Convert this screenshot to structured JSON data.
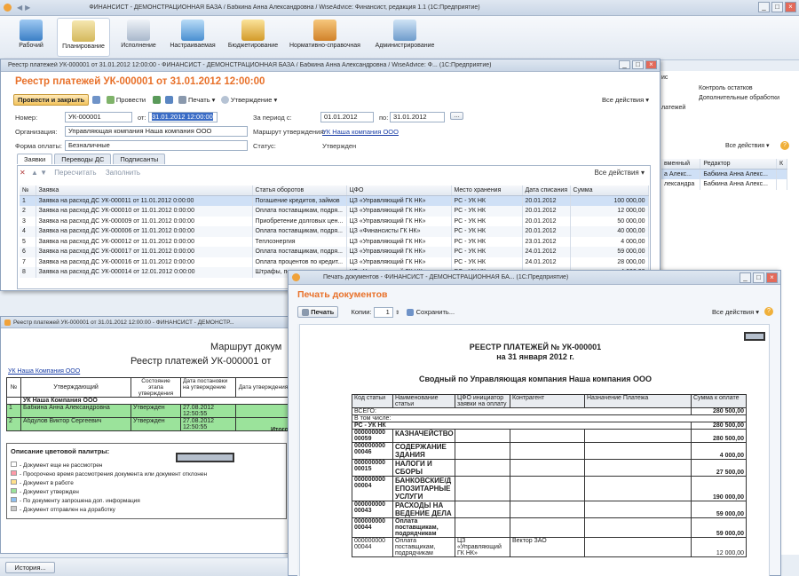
{
  "app": {
    "title": "ФИНАНСИСТ - ДЕМОНСТРАЦИОННАЯ БАЗА / Бабкина Анна Александровна / WiseAdvice: Финансист, редакция 1.1  (1С:Предприятие)",
    "sections": [
      "Рабочий",
      "Планирование",
      "Исполнение",
      "Настраиваемая",
      "Бюджетирование",
      "Нормативно-справочная",
      "Администрирование"
    ],
    "right_items": [
      "Контроль остатков",
      "Дополнительные обработки"
    ],
    "right_partial": [
      "ис",
      "латежей"
    ],
    "all_actions": "Все действия ▾",
    "back_grid": {
      "headers": [
        "вменный",
        "Редактор",
        "К"
      ],
      "rows": [
        [
          "а Алекс...",
          "Бабкина Анна Алекс..."
        ],
        [
          "лександра",
          "Бабкина Анна Алекс..."
        ]
      ]
    },
    "history_btn": "История..."
  },
  "reg": {
    "window_title": "Реестр платежей УК-000001 от 31.01.2012 12:00:00 - ФИНАНСИСТ - ДЕМОНСТРАЦИОННАЯ БАЗА / Бабкина Анна Александровна / WiseAdvice: Ф... (1С:Предприятие)",
    "header": "Реестр платежей УК-000001 от 31.01.2012 12:00:00",
    "toolbar": {
      "post_close": "Провести и закрыть",
      "post": "Провести",
      "print": "Печать ▾",
      "approval": "Утверждение ▾",
      "all_actions": "Все действия ▾"
    },
    "form": {
      "number_lbl": "Номер:",
      "number": "УК-000001",
      "from_lbl": "от:",
      "date": "31.01.2012 12:00:00",
      "period_lbl": "За период с:",
      "period_from": "01.01.2012",
      "to_lbl": "по:",
      "period_to": "31.01.2012",
      "org_lbl": "Организация:",
      "org": "Управляющая компания Наша компания ООО",
      "route_lbl": "Маршрут утверждения:",
      "route": "УК Наша компания ООО",
      "pay_lbl": "Форма оплаты:",
      "pay": "Безналичные",
      "status_lbl": "Статус:",
      "status": "Утвержден"
    },
    "tabs": [
      "Заявки",
      "Переводы ДС",
      "Подписанты"
    ],
    "subtoolbar": {
      "recalc": "Пересчитать",
      "fill": "Заполнить",
      "all_actions": "Все действия ▾"
    },
    "grid_headers": [
      "№",
      "Заявка",
      "Статья оборотов",
      "ЦФО",
      "Место хранения",
      "Дата списания",
      "Сумма"
    ],
    "rows": [
      [
        "1",
        "Заявка на расход ДС УК-000011 от 11.01.2012 0:00:00",
        "Погашение кредитов, займов",
        "ЦЗ «Управляющий ГК НК»",
        "РС - УК НК",
        "20.01.2012",
        "100 000,00"
      ],
      [
        "2",
        "Заявка на расход ДС УК-000010 от 11.01.2012 0:00:00",
        "Оплата поставщикам, подря...",
        "ЦЗ «Управляющий ГК НК»",
        "РС - УК НК",
        "20.01.2012",
        "12 000,00"
      ],
      [
        "3",
        "Заявка на расход ДС УК-000009 от 11.01.2012 0:00:00",
        "Приобретение долговых цен...",
        "ЦЗ «Управляющий ГК НК»",
        "РС - УК НК",
        "20.01.2012",
        "50 000,00"
      ],
      [
        "4",
        "Заявка на расход ДС УК-000006 от 11.01.2012 0:00:00",
        "Оплата поставщикам, подря...",
        "ЦЗ «Финансисты ГК НК»",
        "РС - УК НК",
        "20.01.2012",
        "40 000,00"
      ],
      [
        "5",
        "Заявка на расход ДС УК-000012 от 11.01.2012 0:00:00",
        "Теплоэнергия",
        "ЦЗ «Управляющий ГК НК»",
        "РС - УК НК",
        "23.01.2012",
        "4 000,00"
      ],
      [
        "6",
        "Заявка на расход ДС УК-000017 от 11.01.2012 0:00:00",
        "Оплата поставщикам, подря...",
        "ЦЗ «Управляющий ГК НК»",
        "РС - УК НК",
        "24.01.2012",
        "59 000,00"
      ],
      [
        "7",
        "Заявка на расход ДС УК-000016 от 11.01.2012 0:00:00",
        "Оплата процентов по кредит...",
        "ЦЗ «Управляющий ГК НК»",
        "РС - УК НК",
        "24.01.2012",
        "28 000,00"
      ],
      [
        "8",
        "Заявка на расход ДС УК-000014 от 12.01.2012 0:00:00",
        "Штрафы, пени...",
        "ЦЗ «Управляющий ГК НК»",
        "РС - УК НК",
        "",
        "4 000,00"
      ]
    ]
  },
  "route": {
    "window_title": "Реестр платежей УК-000001 от 31.01.2012 12:00:00 - ФИНАНСИСТ - ДЕМОНСТР...",
    "title1": "Маршрут докум",
    "title2": "Реестр платежей УК-000001 от",
    "org": "УК Наша Компания ООО",
    "headers": [
      "№",
      "Утверждающий",
      "Состояние этапа утверждения",
      "Дата постановки на утверждение",
      "Дата утверждения"
    ],
    "group": "УК Наша Компания ООО",
    "rows": [
      [
        "1",
        "Бабкина Анна Александровна",
        "Утвержден",
        "27.08.2012 12:50:55"
      ],
      [
        "2",
        "Абдулов Виктор Сергеевич",
        "Утвержден",
        "27.08.2012 12:50:55"
      ]
    ],
    "total": "Итого",
    "legend_title": "Описание цветовой палитры:",
    "legend": [
      {
        "color": "#ffffff",
        "text": "- Документ еще не рассмотрен"
      },
      {
        "color": "#ff9aa8",
        "text": "- Просрочено время рассмотрения документа или документ отклонен"
      },
      {
        "color": "#ffe08a",
        "text": "- Документ в работе"
      },
      {
        "color": "#9be39b",
        "text": "- Документ утвержден"
      },
      {
        "color": "#8fc0ef",
        "text": "- По документу запрошена доп. информация"
      },
      {
        "color": "#c9c9c9",
        "text": "- Документ отправлен на доработку"
      }
    ]
  },
  "print": {
    "window_title": "Печать документов - ФИНАНСИСТ - ДЕМОНСТРАЦИОННАЯ БА... (1С:Предприятие)",
    "header": "Печать документов",
    "print_btn": "Печать",
    "copies_lbl": "Копии:",
    "copies": "1",
    "save": "Сохранить...",
    "all_actions": "Все действия ▾",
    "doc_title": "РЕЕСТР ПЛАТЕЖЕЙ № УК-000001",
    "doc_date": "на 31 января 2012 г.",
    "doc_sub": "Сводный по Управляющая компания Наша компания ООО",
    "headers": [
      "Код статьи",
      "Наименование статьи",
      "ЦФО инициатор заявки на оплату",
      "Контрагент",
      "Назначение Платежа",
      "Сумма к оплате"
    ],
    "total_lbl": "ВСЕГО:",
    "total": "280 500,00",
    "incl": "В том числе:",
    "store": "РС - УК НК",
    "store_sum": "280 500,00",
    "rows": [
      [
        "000000000 00059",
        "КАЗНАЧЕЙСТВО",
        "",
        "",
        "",
        "280 500,00"
      ],
      [
        "000000000 00046",
        "СОДЕРЖАНИЕ ЗДАНИЯ",
        "",
        "",
        "",
        "4 000,00"
      ],
      [
        "000000000 00015",
        "НАЛОГИ И СБОРЫ",
        "",
        "",
        "",
        "27 500,00"
      ],
      [
        "000000000 00004",
        "БАНКОВСКИЕ/Д ЕПОЗИТАРНЫЕ УСЛУГИ",
        "",
        "",
        "",
        "190 000,00"
      ],
      [
        "000000000 00043",
        "РАСХОДЫ НА ВЕДЕНИЕ ДЕЛА",
        "",
        "",
        "",
        "59 000,00"
      ],
      [
        "000000000 00044",
        "Оплата поставщикам, подрядчикам",
        "",
        "",
        "",
        "59 000,00"
      ],
      [
        "000000000 00044",
        "Оплата поставщикам, подрядчикам",
        "ЦЗ «Управляющий ГК НК»",
        "Вектор ЗАО",
        "",
        "12 000,00"
      ]
    ]
  },
  "colors": {
    "accent": "#1f5fb4",
    "title_blue": "#2b6fc1",
    "orange": "#e8712a",
    "approved": "#9be39b"
  }
}
